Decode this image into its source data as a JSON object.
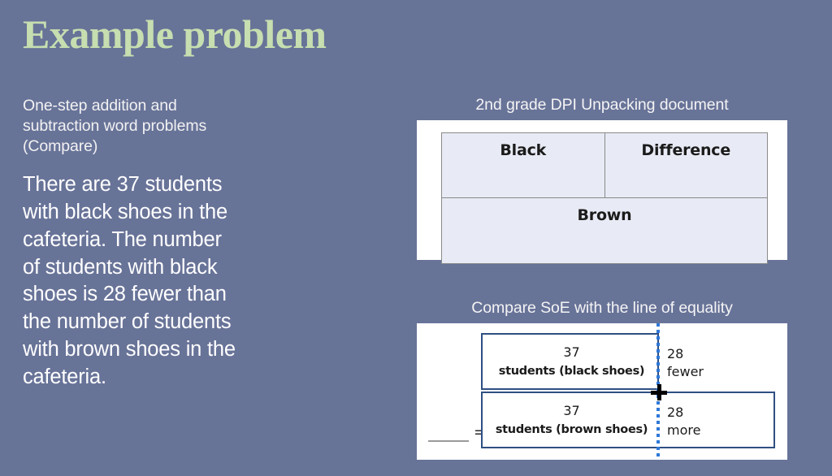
{
  "slide": {
    "title": "Example problem",
    "background_color": "#687398",
    "title_color": "#c6deb0"
  },
  "left": {
    "subhead": "One-step addition and subtraction word problems (Compare)",
    "body": "There are 37 students with black shoes in the cafeteria. The number of students with black shoes is 28 fewer than the number of students with brown shoes in the cafeteria."
  },
  "figures": {
    "dpi": {
      "caption": "2nd grade DPI Unpacking document",
      "table": {
        "row_top": [
          "Black",
          "Difference"
        ],
        "row_bottom": [
          "Brown"
        ]
      },
      "cell_fill": "#e8ebf5",
      "cell_border": "#8a8a8a"
    },
    "soe": {
      "caption": "Compare SoE with the line of equality",
      "equals_sign": "=",
      "bar_border_color": "#2f4f82",
      "equality_line_color": "#2f78d8",
      "bars": [
        {
          "name": "black-shoes",
          "number": "37",
          "label": "students (black shoes)",
          "side_number": "28",
          "side_word": "fewer"
        },
        {
          "name": "brown-shoes",
          "number": "37",
          "label": "students (brown shoes)",
          "side_number": "28",
          "side_word": "more"
        }
      ]
    }
  }
}
